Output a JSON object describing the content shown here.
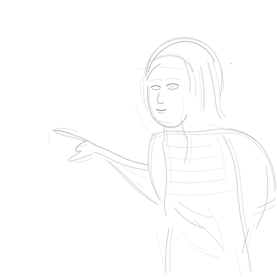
{
  "image": {
    "background_color": "#ffffff",
    "line_colors": [
      "#6f6f6f",
      "#9e9e9e",
      "#b8b8b8",
      "#c9c9c9",
      "#d6d6d6"
    ]
  }
}
